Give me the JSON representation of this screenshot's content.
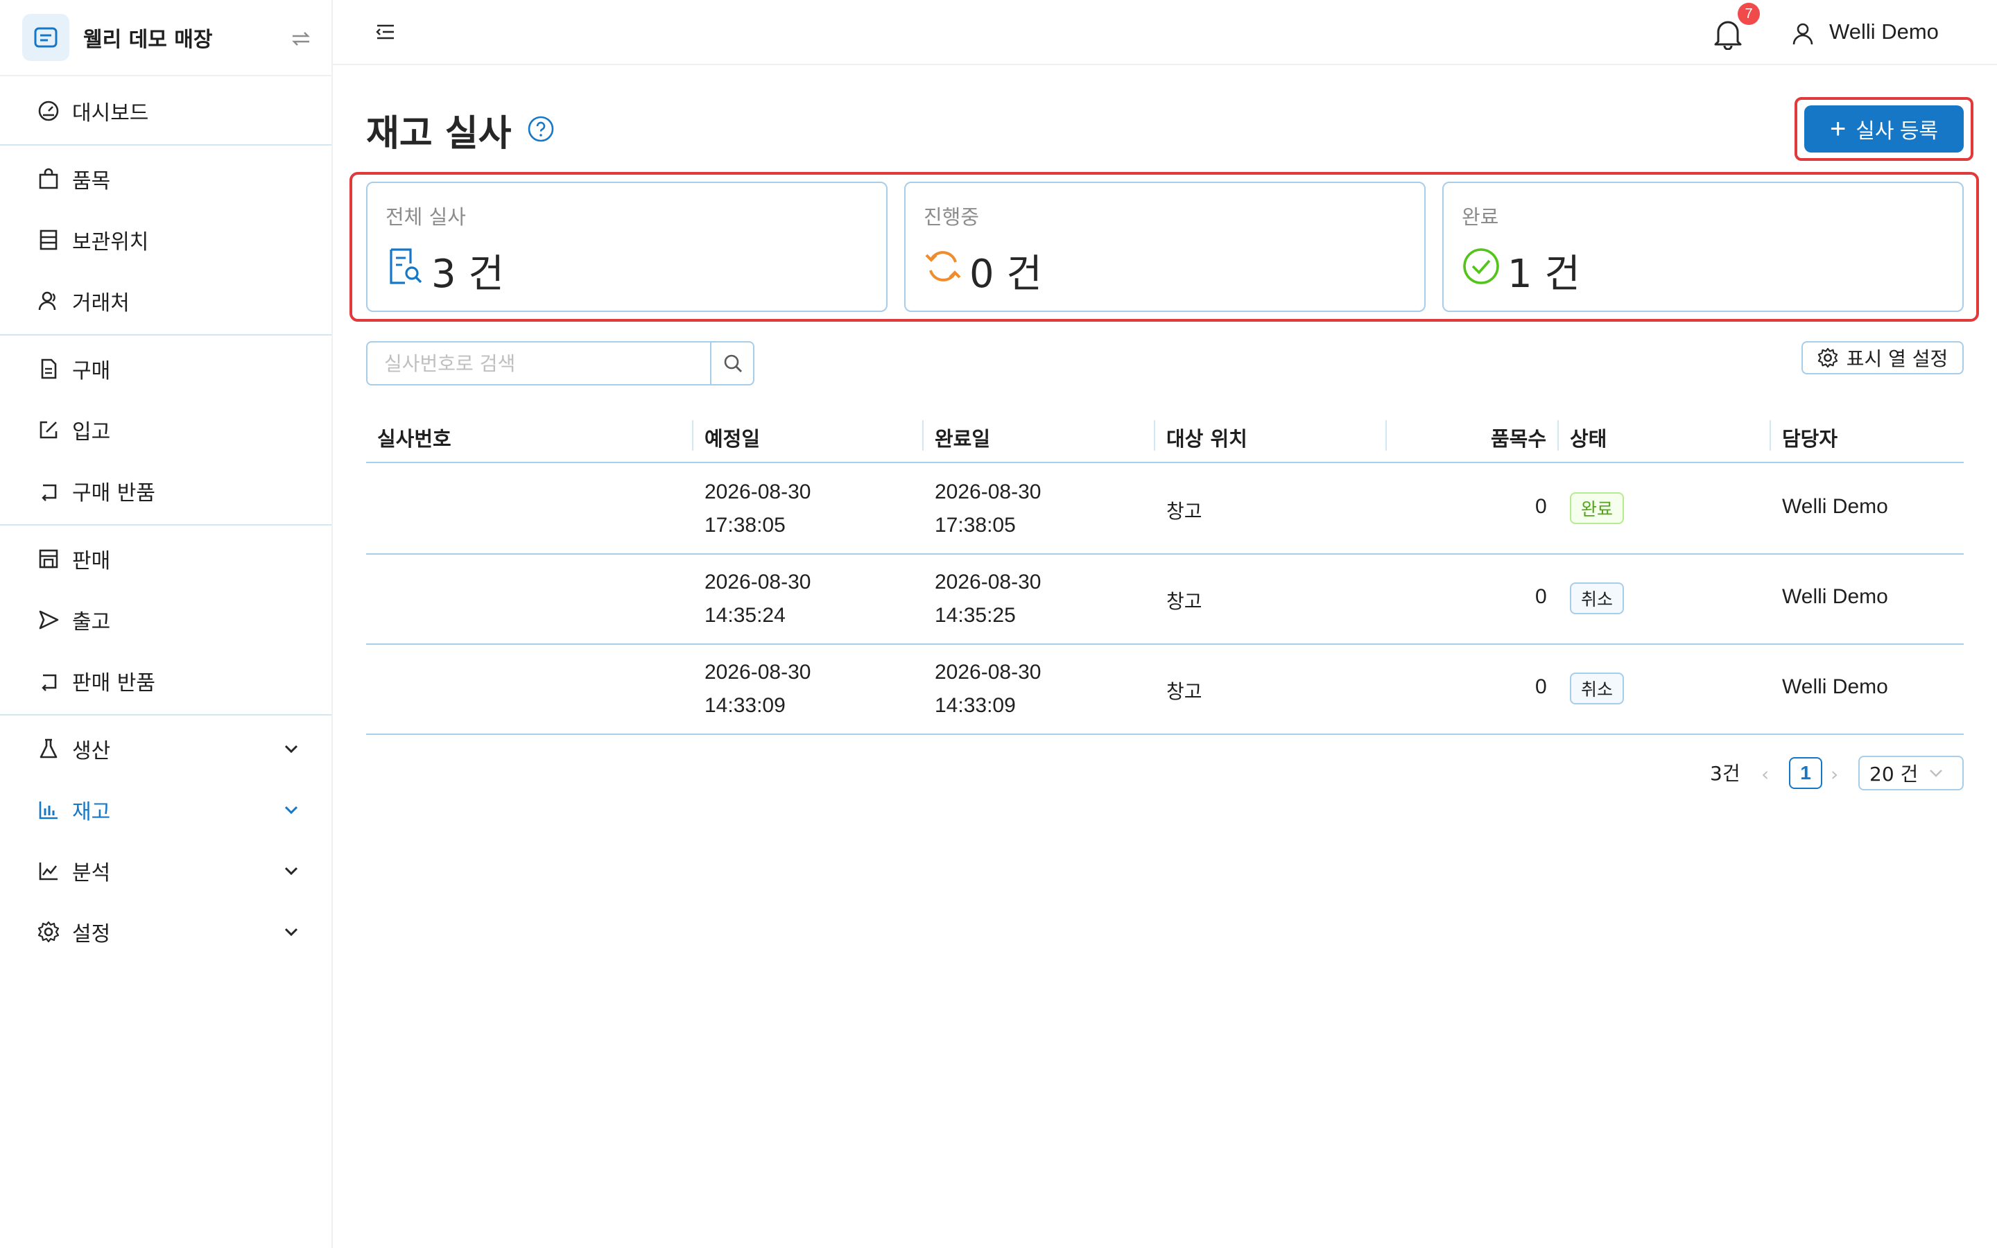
{
  "brand": {
    "name": "웰리 데모 매장"
  },
  "sidebar": {
    "items": [
      {
        "label": "대시보드",
        "icon": "dashboard-icon"
      },
      {
        "label": "품목",
        "icon": "shopping-bag-icon"
      },
      {
        "label": "보관위치",
        "icon": "shelf-icon"
      },
      {
        "label": "거래처",
        "icon": "contacts-icon"
      },
      {
        "label": "구매",
        "icon": "document-icon"
      },
      {
        "label": "입고",
        "icon": "inbound-icon"
      },
      {
        "label": "구매 반품",
        "icon": "return-icon"
      },
      {
        "label": "판매",
        "icon": "store-icon"
      },
      {
        "label": "출고",
        "icon": "send-icon"
      },
      {
        "label": "판매 반품",
        "icon": "return-icon"
      },
      {
        "label": "생산",
        "icon": "flask-icon"
      },
      {
        "label": "재고",
        "icon": "bar-chart-icon",
        "active": true
      },
      {
        "label": "분석",
        "icon": "line-chart-icon"
      },
      {
        "label": "설정",
        "icon": "gear-icon"
      }
    ]
  },
  "header": {
    "notification_count": "7",
    "user_name": "Welli Demo"
  },
  "page": {
    "title": "재고 실사",
    "add_button_label": "실사 등록"
  },
  "stats": [
    {
      "title": "전체 실사",
      "value": "3 건"
    },
    {
      "title": "진행중",
      "value": "0 건"
    },
    {
      "title": "완료",
      "value": "1 건"
    }
  ],
  "search": {
    "placeholder": "실사번호로 검색"
  },
  "column_settings_label": "표시 열 설정",
  "table": {
    "headers": [
      "실사번호",
      "예정일",
      "완료일",
      "대상 위치",
      "품목수",
      "상태",
      "담당자"
    ],
    "rows": [
      {
        "id": "",
        "scheduled_date": "2026-08-30",
        "scheduled_time": "17:38:05",
        "done_date": "2026-08-30",
        "done_time": "17:38:05",
        "location": "창고",
        "items": "0",
        "status": "완료",
        "owner": "Welli Demo"
      },
      {
        "id": "",
        "scheduled_date": "2026-08-30",
        "scheduled_time": "14:35:24",
        "done_date": "2026-08-30",
        "done_time": "14:35:25",
        "location": "창고",
        "items": "0",
        "status": "취소",
        "owner": "Welli Demo"
      },
      {
        "id": "",
        "scheduled_date": "2026-08-30",
        "scheduled_time": "14:33:09",
        "done_date": "2026-08-30",
        "done_time": "14:33:09",
        "location": "창고",
        "items": "0",
        "status": "취소",
        "owner": "Welli Demo"
      }
    ]
  },
  "pagination": {
    "total": "3건",
    "current_page": "1",
    "page_size": "20 건"
  },
  "colors": {
    "primary": "#1677c7",
    "highlight": "#e03a3a",
    "border": "#a7cde9",
    "success": "#52a51a",
    "warning": "#f08c2a",
    "badge": "#f04a4a"
  }
}
